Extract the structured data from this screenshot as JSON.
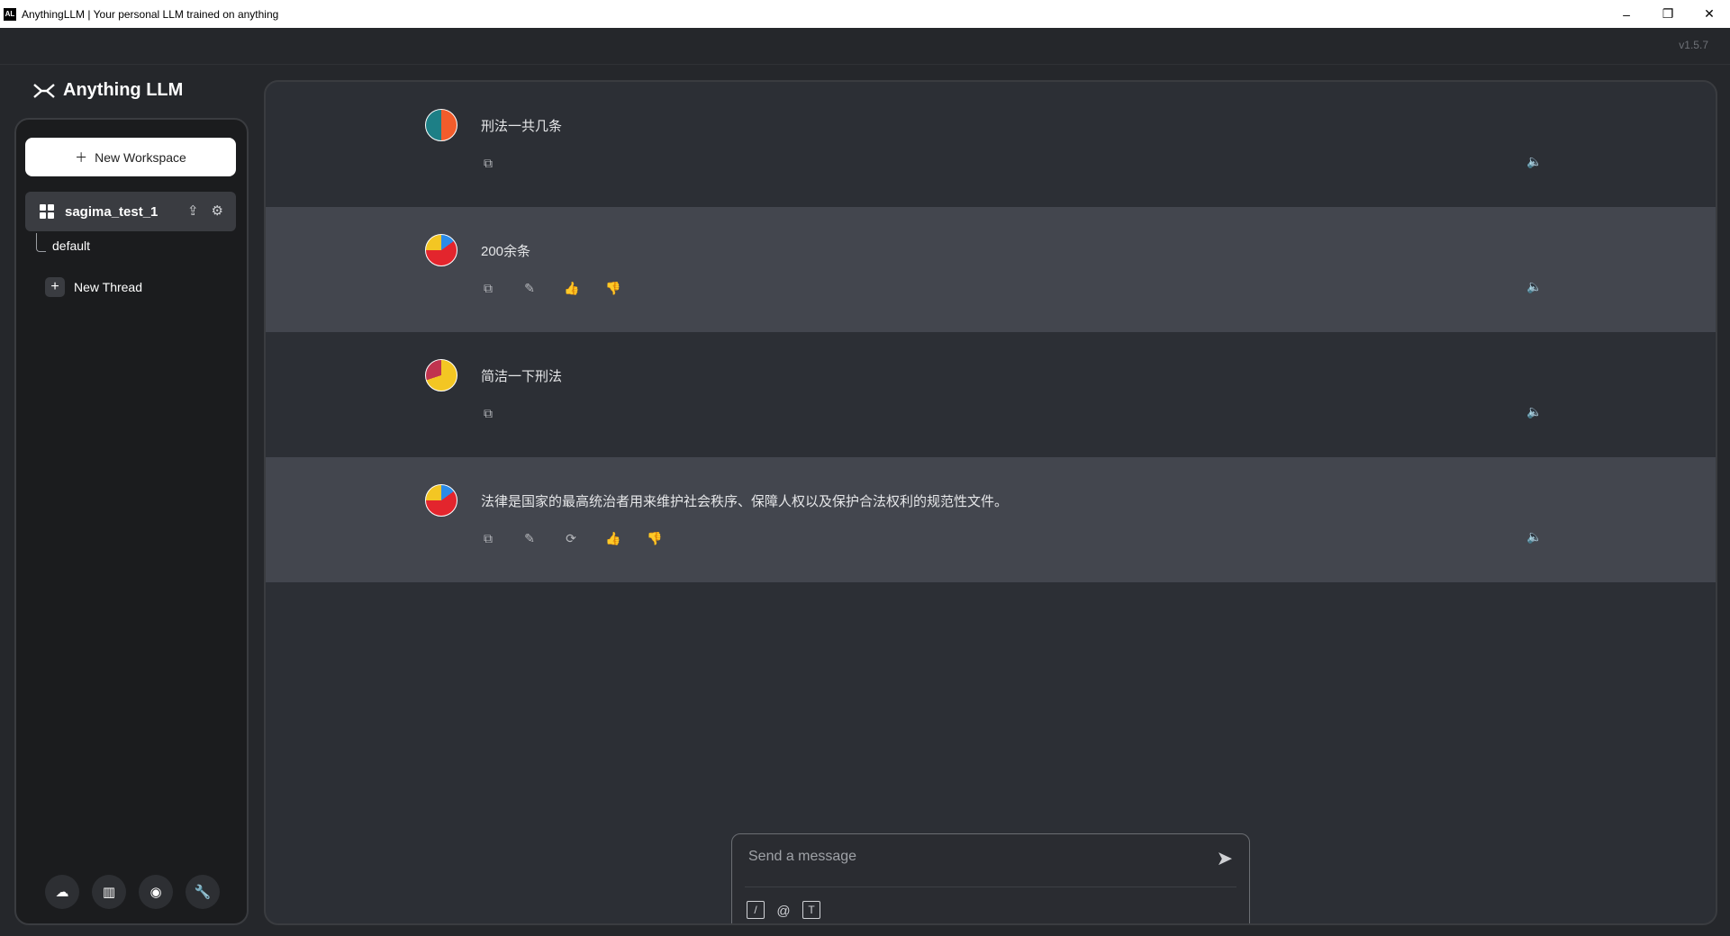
{
  "window": {
    "title": "AnythingLLM | Your personal LLM trained on anything",
    "controls": [
      "–",
      "❐",
      "✕"
    ]
  },
  "app": {
    "version": "v1.5.7",
    "logo_text": "Anything LLM"
  },
  "sidebar": {
    "new_workspace_label": "New Workspace",
    "workspace": {
      "name": "sagima_test_1",
      "icons": [
        "upload-icon",
        "gear-icon"
      ]
    },
    "threads": [
      {
        "label": "default"
      }
    ],
    "new_thread_label": "New Thread",
    "footer_icons": [
      "community-hub-icon",
      "docs-book-icon",
      "discord-icon",
      "settings-wrench-icon"
    ]
  },
  "chat": {
    "messages": [
      {
        "role": "user",
        "text": "刑法一共几条",
        "actions": [
          "copy-icon"
        ],
        "avatar_colors": [
          "#1d7f86",
          "#f25c2b"
        ]
      },
      {
        "role": "assistant",
        "text": "200余条",
        "actions": [
          "copy-icon",
          "edit-icon",
          "thumbs-up-icon",
          "thumbs-down-icon"
        ],
        "avatar_colors": [
          "#f3c623",
          "#e3252d",
          "#2b8be8"
        ]
      },
      {
        "role": "user",
        "text": "简洁一下刑法",
        "actions": [
          "copy-icon"
        ],
        "avatar_colors": [
          "#f3c623",
          "#c0344f"
        ]
      },
      {
        "role": "assistant",
        "text": "法律是国家的最高统治者用来维护社会秩序、保障人权以及保护合法权利的规范性文件。",
        "actions": [
          "copy-icon",
          "edit-icon",
          "regenerate-icon",
          "thumbs-up-icon",
          "thumbs-down-icon"
        ],
        "avatar_colors": [
          "#f3c623",
          "#e3252d",
          "#2b8be8"
        ]
      }
    ]
  },
  "composer": {
    "placeholder": "Send a message",
    "tools": [
      "slash-command-icon",
      "at-mention-icon",
      "text-format-icon"
    ]
  }
}
